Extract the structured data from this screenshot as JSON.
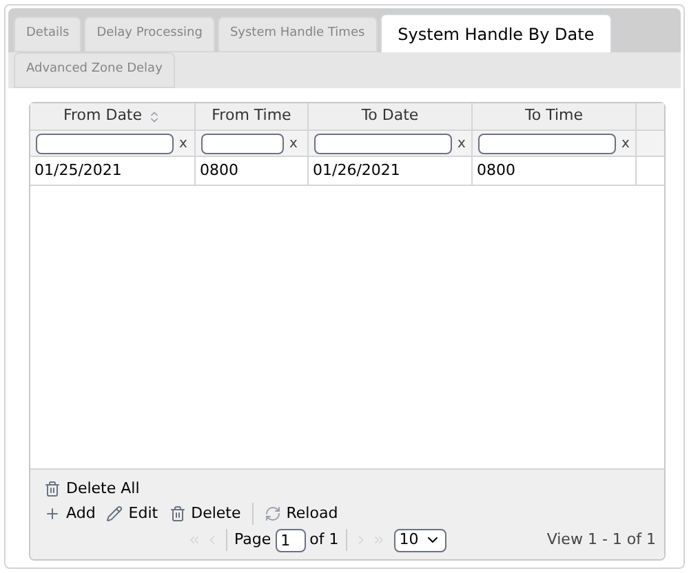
{
  "tabs": [
    {
      "label": "Details",
      "selected": false
    },
    {
      "label": "Delay Processing",
      "selected": false
    },
    {
      "label": "System Handle Times",
      "selected": false
    },
    {
      "label": "System Handle By Date",
      "selected": true
    },
    {
      "label": "Advanced Zone Delay",
      "selected": false
    }
  ],
  "grid": {
    "columns": [
      {
        "label": "From Date",
        "sorted": true,
        "clear_label": "x"
      },
      {
        "label": "From Time",
        "sorted": false,
        "clear_label": "x"
      },
      {
        "label": "To Date",
        "sorted": false,
        "clear_label": "x"
      },
      {
        "label": "To Time",
        "sorted": false,
        "clear_label": "x"
      }
    ],
    "rows": [
      [
        "01/25/2021",
        "0800",
        "01/26/2021",
        "0800"
      ]
    ]
  },
  "toolbar": {
    "top": [
      {
        "kind": "delete",
        "label": "Delete All"
      }
    ],
    "bottom": [
      {
        "kind": "add",
        "label": "Add"
      },
      {
        "kind": "edit",
        "label": "Edit"
      },
      {
        "kind": "delete",
        "label": "Delete"
      },
      {
        "kind": "reload",
        "label": "Reload"
      }
    ]
  },
  "pager": {
    "page_label": "Page",
    "page": "1",
    "of_label": "of 1",
    "page_size": "10",
    "view": "View 1 - 1 of 1"
  }
}
